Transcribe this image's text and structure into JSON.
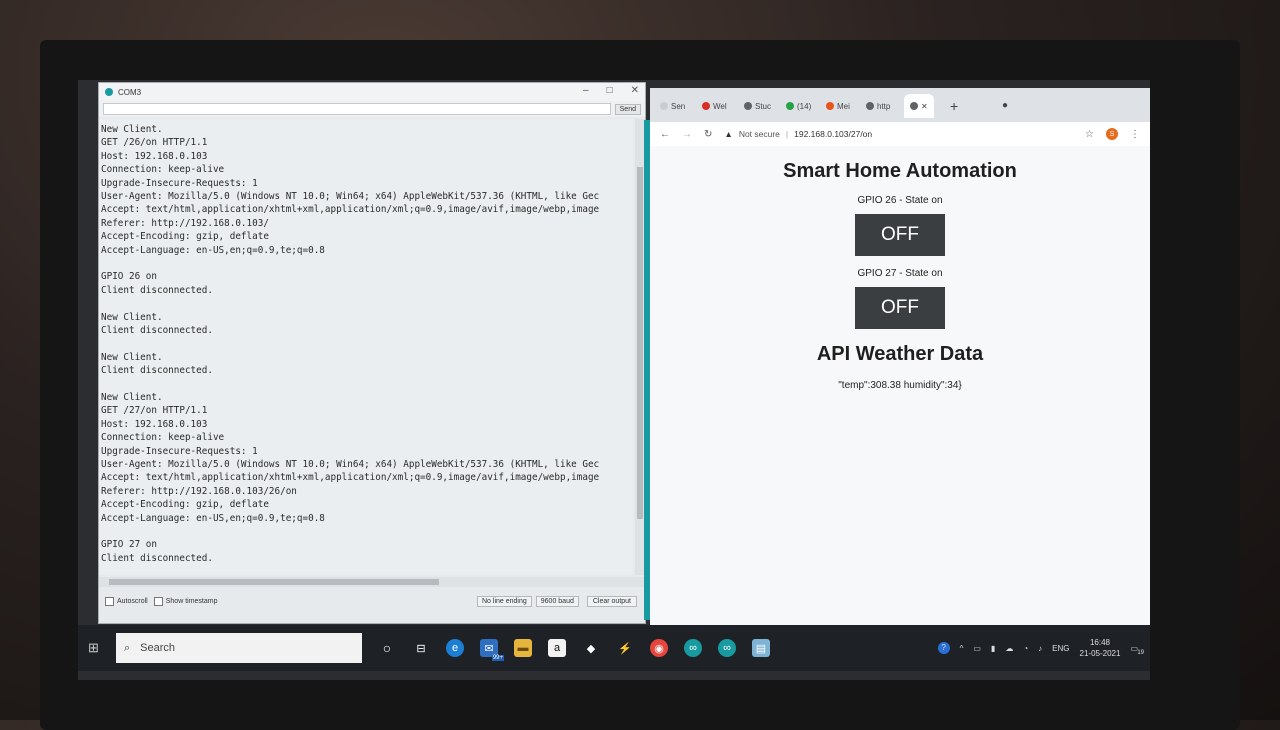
{
  "serial": {
    "title": "COM3",
    "send_label": "Send",
    "lines": [
      "New Client.",
      "GET /26/on HTTP/1.1",
      "Host: 192.168.0.103",
      "Connection: keep-alive",
      "Upgrade-Insecure-Requests: 1",
      "User-Agent: Mozilla/5.0 (Windows NT 10.0; Win64; x64) AppleWebKit/537.36 (KHTML, like Gec",
      "Accept: text/html,application/xhtml+xml,application/xml;q=0.9,image/avif,image/webp,image",
      "Referer: http://192.168.0.103/",
      "Accept-Encoding: gzip, deflate",
      "Accept-Language: en-US,en;q=0.9,te;q=0.8",
      "",
      "GPIO 26 on",
      "Client disconnected.",
      "",
      "New Client.",
      "Client disconnected.",
      "",
      "New Client.",
      "Client disconnected.",
      "",
      "New Client.",
      "GET /27/on HTTP/1.1",
      "Host: 192.168.0.103",
      "Connection: keep-alive",
      "Upgrade-Insecure-Requests: 1",
      "User-Agent: Mozilla/5.0 (Windows NT 10.0; Win64; x64) AppleWebKit/537.36 (KHTML, like Gec",
      "Accept: text/html,application/xhtml+xml,application/xml;q=0.9,image/avif,image/webp,image",
      "Referer: http://192.168.0.103/26/on",
      "Accept-Encoding: gzip, deflate",
      "Accept-Language: en-US,en;q=0.9,te;q=0.8",
      "",
      "GPIO 27 on",
      "Client disconnected."
    ],
    "autoscroll_label": "Autoscroll",
    "timestamp_label": "Show timestamp",
    "line_ending": "No line ending",
    "baud": "9600 baud",
    "clear_label": "Clear output"
  },
  "chrome": {
    "tabs": [
      "Sen",
      "Wel",
      "Stuc",
      "(14)",
      "Mei",
      "http"
    ],
    "url_security": "Not secure",
    "url": "192.168.0.103/27/on",
    "profile_initial": "S"
  },
  "page": {
    "title": "Smart Home Automation",
    "gpio26_state": "GPIO 26 - State on",
    "gpio26_button": "OFF",
    "gpio27_state": "GPIO 27 - State on",
    "gpio27_button": "OFF",
    "weather_heading": "API Weather Data",
    "weather_text": "\"temp\":308.38 humidity\":34}"
  },
  "taskbar": {
    "search_placeholder": "Search",
    "mail_badge": "99+",
    "lang": "ENG",
    "time": "16:48",
    "date": "21-05-2021",
    "notification_count": "19"
  }
}
